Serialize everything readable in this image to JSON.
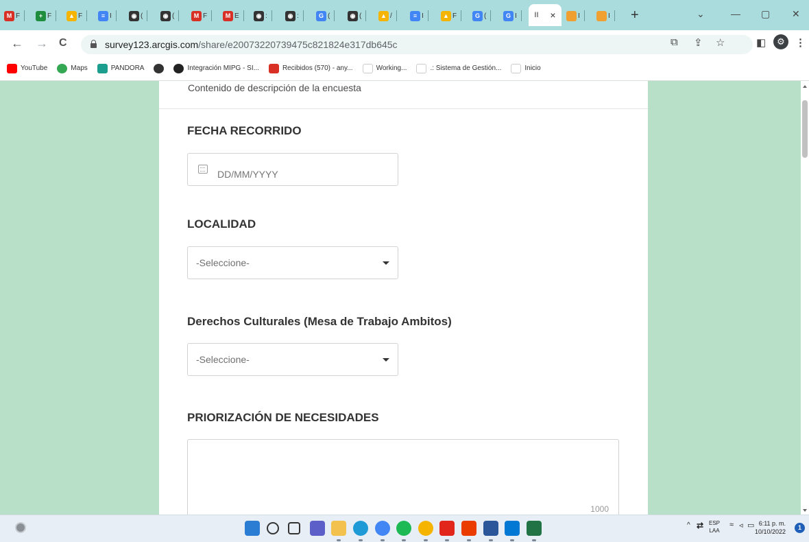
{
  "browser": {
    "tabs": [
      {
        "icon": "gmail-icon",
        "letter": "M",
        "color": "#d93025",
        "label": "F"
      },
      {
        "icon": "sheets-plus-icon",
        "letter": "+",
        "color": "#1e8e3e",
        "label": "F"
      },
      {
        "icon": "drive-icon",
        "letter": "▲",
        "color": "#f4b400",
        "label": "F"
      },
      {
        "icon": "docs-icon",
        "letter": "≡",
        "color": "#4285f4",
        "label": "I"
      },
      {
        "icon": "globe-icon",
        "letter": "◉",
        "color": "#333333",
        "label": "("
      },
      {
        "icon": "globe-icon",
        "letter": "◉",
        "color": "#333333",
        "label": "("
      },
      {
        "icon": "gmail-icon",
        "letter": "M",
        "color": "#d93025",
        "label": "F"
      },
      {
        "icon": "gmail-icon",
        "letter": "M",
        "color": "#d93025",
        "label": "E"
      },
      {
        "icon": "globe-icon",
        "letter": "◉",
        "color": "#333333",
        "label": ":"
      },
      {
        "icon": "globe-icon",
        "letter": "◉",
        "color": "#333333",
        "label": ":"
      },
      {
        "icon": "google-icon",
        "letter": "G",
        "color": "#4285f4",
        "label": "("
      },
      {
        "icon": "globe-icon",
        "letter": "◉",
        "color": "#333333",
        "label": "("
      },
      {
        "icon": "drive-icon",
        "letter": "▲",
        "color": "#f4b400",
        "label": "/"
      },
      {
        "icon": "docs-icon",
        "letter": "≡",
        "color": "#4285f4",
        "label": "I"
      },
      {
        "icon": "drive-icon",
        "letter": "▲",
        "color": "#f4b400",
        "label": "F"
      },
      {
        "icon": "google-icon",
        "letter": "G",
        "color": "#4285f4",
        "label": "("
      },
      {
        "icon": "google-icon",
        "letter": "G",
        "color": "#4285f4",
        "label": "I"
      }
    ],
    "active_tab": {
      "label": "II",
      "close": "×"
    },
    "extra_tabs": [
      {
        "icon": "survey123-icon",
        "color": "#f0a030",
        "label": "I"
      },
      {
        "icon": "survey123-icon",
        "color": "#f0a030",
        "label": "I"
      }
    ],
    "new_tab": "+",
    "window_controls": {
      "dropdown": "⌄",
      "minimize": "—",
      "restore": "▢",
      "close": "✕"
    },
    "nav": {
      "back": "←",
      "forward": "→",
      "reload": "C"
    },
    "url_host": "survey123.arcgis.com",
    "url_path": "/share/e20073220739475c821824e317db645c",
    "toolbar_icons": {
      "translate": "⧉",
      "share": "⇪",
      "star": "☆",
      "sidepanel": "◧",
      "profile": "⚙",
      "menu": "⋮"
    },
    "bookmarks": [
      {
        "label": "YouTube",
        "icon": "youtube-icon",
        "color": "#ff0000"
      },
      {
        "label": "Maps",
        "icon": "maps-icon",
        "color": "#34a853"
      },
      {
        "label": "PANDORA",
        "icon": "pandora-icon",
        "color": "#1b9e8e"
      },
      {
        "label": "",
        "icon": "globe-icon",
        "color": "#333333"
      },
      {
        "label": "Integración MIPG - SI...",
        "icon": "mipg-icon",
        "color": "#222222"
      },
      {
        "label": "Recibidos (570) - any...",
        "icon": "gmail-icon",
        "color": "#d93025"
      },
      {
        "label": "Working...",
        "icon": "page-icon",
        "color": "#ffffff"
      },
      {
        "label": ".: Sistema de Gestión...",
        "icon": "user-icon",
        "color": "#ffffff"
      },
      {
        "label": "Inicio",
        "icon": "page-icon",
        "color": "#ffffff"
      }
    ]
  },
  "survey": {
    "description": "Contenido de descripción de la encuesta",
    "q1_label": "FECHA RECORRIDO",
    "q1_placeholder": "DD/MM/YYYY",
    "q2_label": "LOCALIDAD",
    "q2_value": "-Seleccione-",
    "q3_label": "Derechos Culturales (Mesa de Trabajo Ambitos)",
    "q3_value": "-Seleccione-",
    "q4_label": "PRIORIZACIÓN DE NECESIDADES",
    "q4_counter": "1000"
  },
  "taskbar": {
    "apps": [
      {
        "icon": "windows-start-icon",
        "color": "#2b7cd3"
      },
      {
        "icon": "search-icon",
        "color": "#333333"
      },
      {
        "icon": "task-view-icon",
        "color": "#333333"
      },
      {
        "icon": "chat-icon",
        "color": "#5b5fc7"
      },
      {
        "icon": "file-explorer-icon",
        "color": "#f2c14e"
      },
      {
        "icon": "edge-icon",
        "color": "#1e9bd7"
      },
      {
        "icon": "chrome-icon",
        "color": "#4285f4"
      },
      {
        "icon": "spotify-icon",
        "color": "#1db954"
      },
      {
        "icon": "chrome-canary-icon",
        "color": "#f4b400"
      },
      {
        "icon": "acrobat-icon",
        "color": "#e3261c"
      },
      {
        "icon": "office-icon",
        "color": "#eb3c00"
      },
      {
        "icon": "word-icon",
        "color": "#2b579a"
      },
      {
        "icon": "photos-icon",
        "color": "#0078d4"
      },
      {
        "icon": "excel-icon",
        "color": "#217346"
      }
    ],
    "tray_chevron": "^",
    "lang_top": "ESP",
    "lang_bottom": "LAA",
    "time": "6:11 p. m.",
    "date": "10/10/2022",
    "notifications": "1"
  }
}
